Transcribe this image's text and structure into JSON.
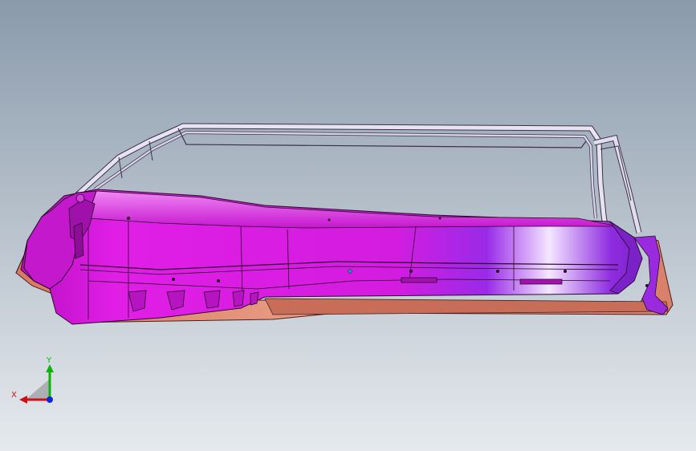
{
  "viewport": {
    "background_top": "#8a9aab",
    "background_bottom": "#e6eaee"
  },
  "model": {
    "body_color": "#e01ee6",
    "highlight_color": "#ffffff",
    "frame_color": "#e7e3f2",
    "flange_color": "#e9957c",
    "edge_color": "#2a0a2a"
  },
  "triad": {
    "x_label": "X",
    "y_label": "Y",
    "x_color": "#d01010",
    "y_color": "#10b010",
    "z_color": "#1028d0"
  }
}
